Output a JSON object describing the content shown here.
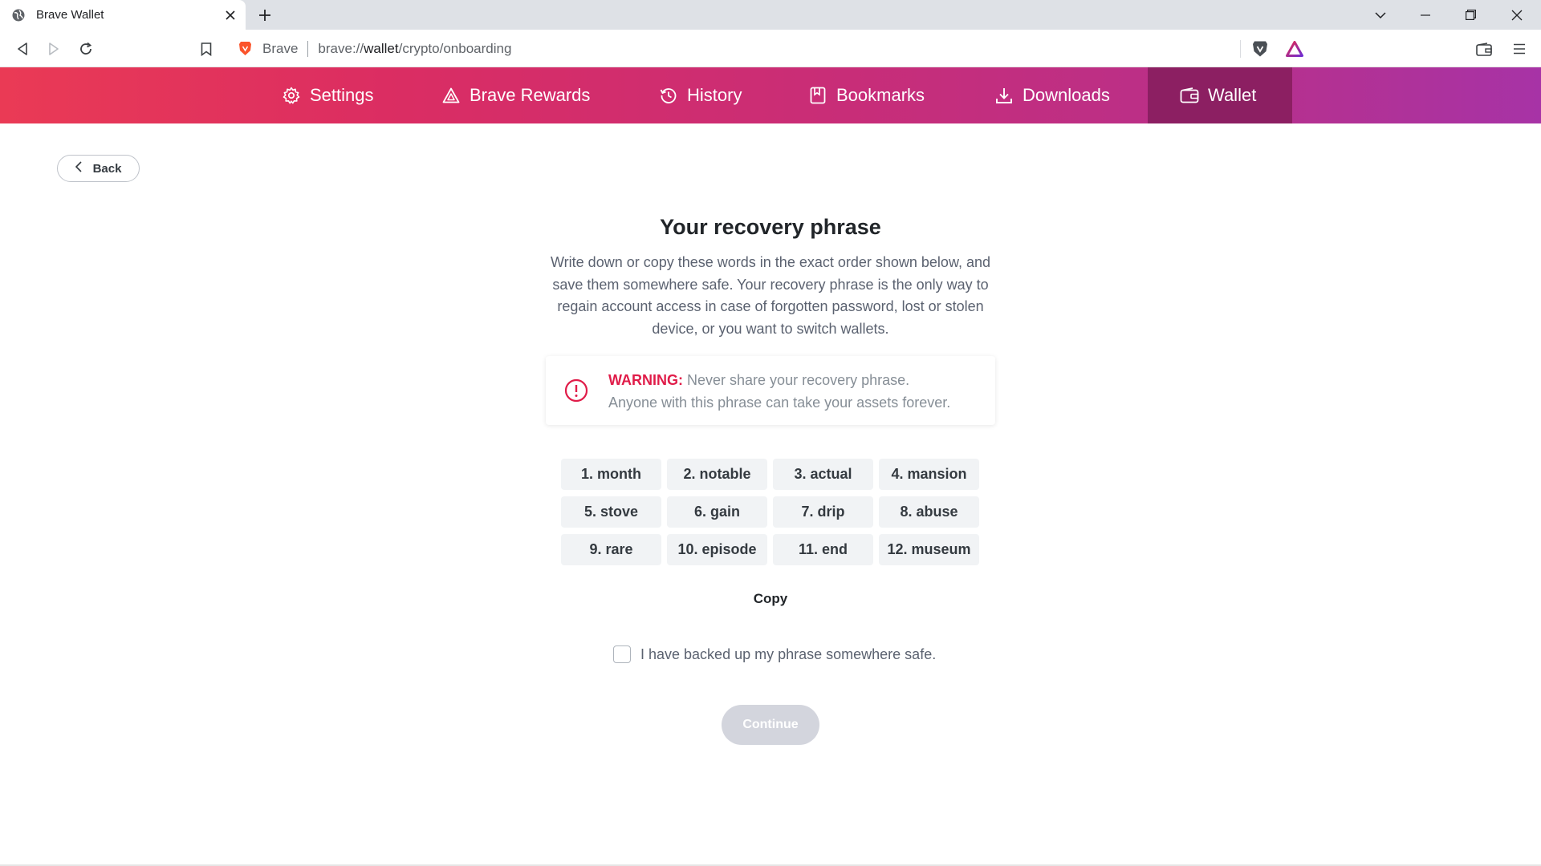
{
  "browser": {
    "tab_title": "Brave Wallet",
    "omnibox_brand": "Brave",
    "url_prefix": "brave://",
    "url_host": "wallet",
    "url_path": "/crypto/onboarding"
  },
  "nav": {
    "items": [
      {
        "label": "Settings",
        "icon": "gear-icon"
      },
      {
        "label": "Brave Rewards",
        "icon": "rewards-triangle-icon"
      },
      {
        "label": "History",
        "icon": "history-icon"
      },
      {
        "label": "Bookmarks",
        "icon": "bookmark-icon"
      },
      {
        "label": "Downloads",
        "icon": "download-icon"
      },
      {
        "label": "Wallet",
        "icon": "wallet-icon",
        "active": true
      }
    ]
  },
  "back_label": "Back",
  "page": {
    "title": "Your recovery phrase",
    "description": "Write down or copy these words in the exact order shown below, and save them somewhere safe. Your recovery phrase is the only way to regain account access in case of forgotten password, lost or stolen device, or you want to switch wallets."
  },
  "warning": {
    "label": "WARNING:",
    "line1": "Never share your recovery phrase.",
    "line2": "Anyone with this phrase can take your assets forever."
  },
  "words": [
    "1. month",
    "2. notable",
    "3. actual",
    "4. mansion",
    "5. stove",
    "6. gain",
    "7. drip",
    "8. abuse",
    "9. rare",
    "10. episode",
    "11. end",
    "12. museum"
  ],
  "copy_label": "Copy",
  "backup_checkbox_label": "I have backed up my phrase somewhere safe.",
  "backup_checked": false,
  "continue_label": "Continue",
  "colors": {
    "warning_red": "#e01c49",
    "nav_active": "#8c1f62",
    "button_disabled": "#d3d5dd"
  }
}
